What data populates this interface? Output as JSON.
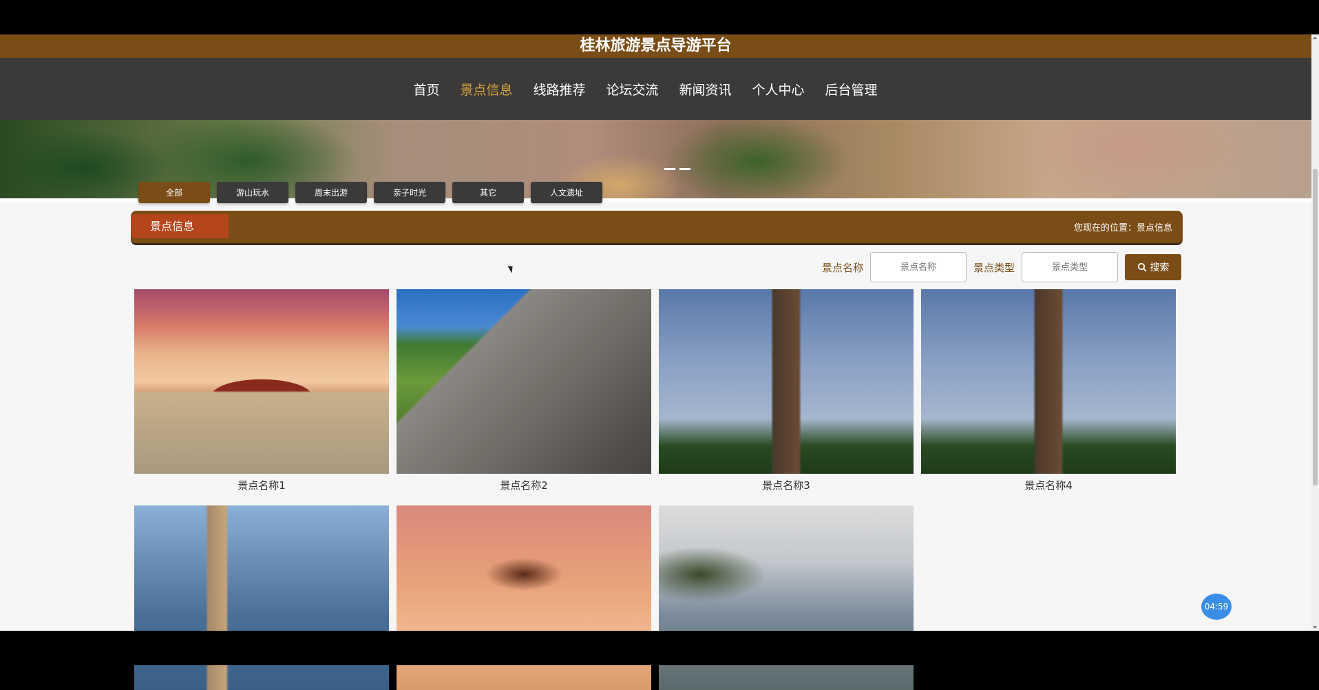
{
  "header": {
    "title": "桂林旅游景点导游平台"
  },
  "nav": {
    "items": [
      {
        "label": "首页",
        "active": false
      },
      {
        "label": "景点信息",
        "active": true
      },
      {
        "label": "线路推荐",
        "active": false
      },
      {
        "label": "论坛交流",
        "active": false
      },
      {
        "label": "新闻资讯",
        "active": false
      },
      {
        "label": "个人中心",
        "active": false
      },
      {
        "label": "后台管理",
        "active": false
      }
    ]
  },
  "categories": {
    "items": [
      "全部",
      "游山玩水",
      "周末出游",
      "亲子时光",
      "其它",
      "人文遗址"
    ],
    "selected": "全部"
  },
  "section": {
    "title": "景点信息",
    "breadcrumb": "您现在的位置：景点信息"
  },
  "search": {
    "name_label": "景点名称",
    "name_placeholder": "景点名称",
    "type_label": "景点类型",
    "type_placeholder": "景点类型",
    "button_label": "搜索"
  },
  "attractions": [
    {
      "name": "景点名称1",
      "image": "palace"
    },
    {
      "name": "景点名称2",
      "image": "great-wall"
    },
    {
      "name": "景点名称3",
      "image": "pagoda"
    },
    {
      "name": "景点名称4",
      "image": "pagoda"
    },
    {
      "name": "",
      "image": "coast"
    },
    {
      "name": "",
      "image": "tower"
    },
    {
      "name": "",
      "image": "mountain"
    }
  ],
  "timer": "04:59",
  "colors": {
    "brand": "#7a4d17",
    "nav_bg": "#3b3a39",
    "active_nav": "#d7a33b",
    "section_title": "#b5451b"
  }
}
